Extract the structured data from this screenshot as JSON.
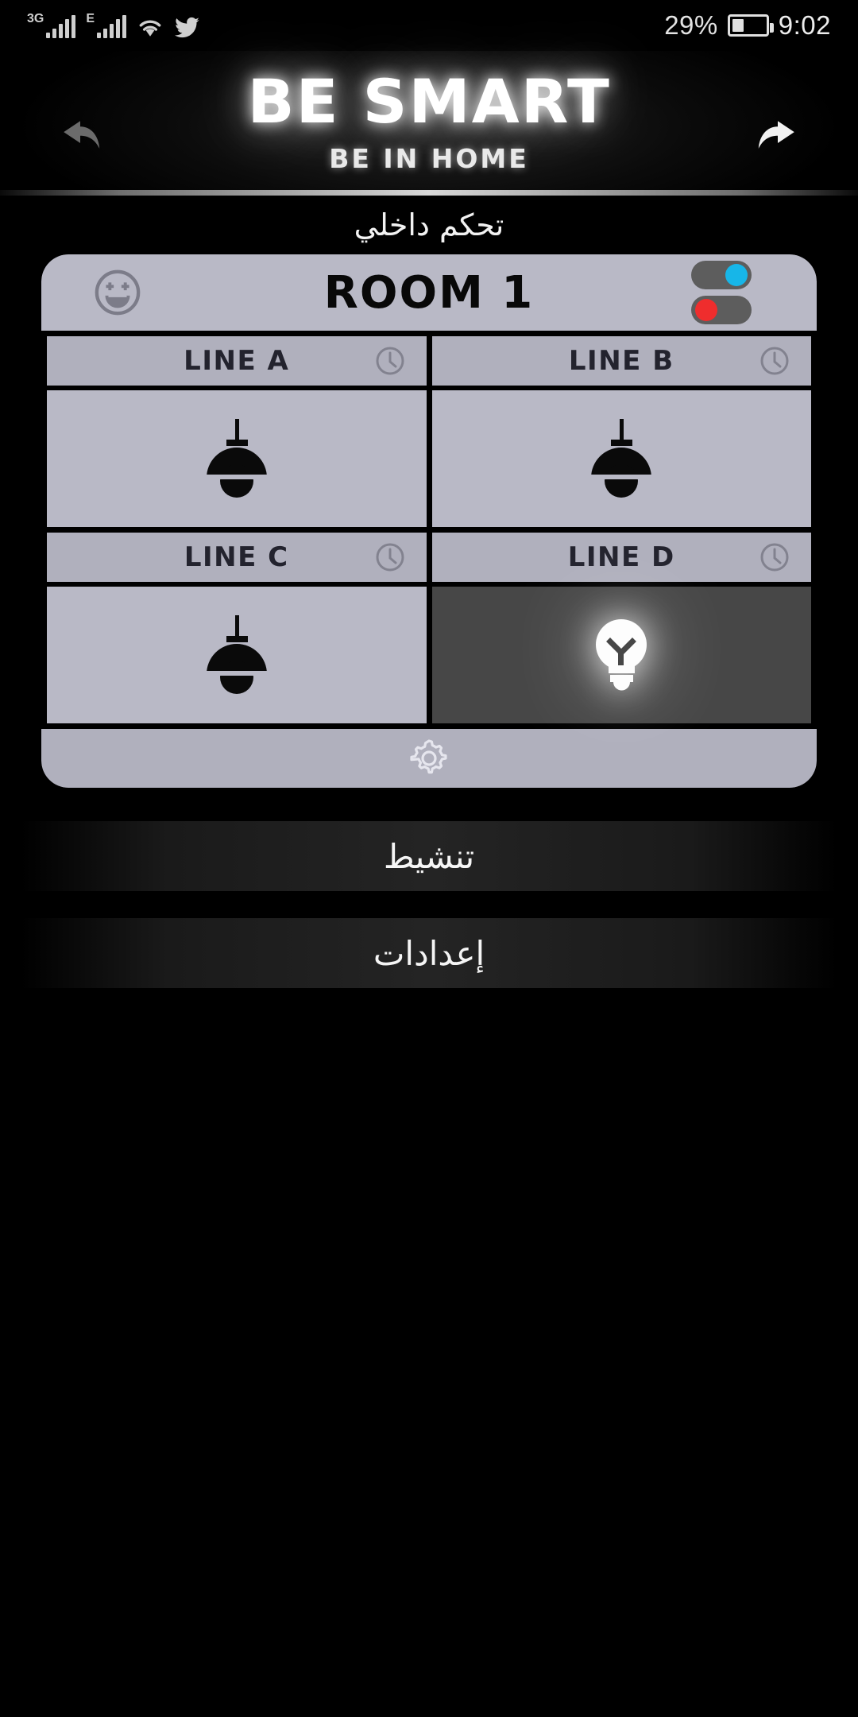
{
  "statusbar": {
    "network_tag_1": "3G",
    "network_tag_2": "E",
    "wifi_icon": "wifi-icon",
    "twitter_icon": "twitter-bird-icon",
    "battery_percent": "29%",
    "time": "9:02"
  },
  "header": {
    "back_icon": "back-arrow-icon",
    "forward_icon": "forward-arrow-icon",
    "title": "BE SMART",
    "subtitle": "BE IN HOME"
  },
  "section": {
    "caption": "تحكم داخلي"
  },
  "room_card": {
    "mood_icon": "smiley-face-icon",
    "title": "ROOM 1",
    "toggles": [
      {
        "name": "power-toggle",
        "state": "on",
        "knob_color": "#17b6e8"
      },
      {
        "name": "alarm-toggle",
        "state": "off",
        "knob_color": "#ef2d2d"
      }
    ],
    "lines": [
      {
        "label": "LINE A",
        "timer_icon": "clock-icon",
        "lamp_state": "off",
        "lamp_icon": "pendant-lamp-icon"
      },
      {
        "label": "LINE B",
        "timer_icon": "clock-icon",
        "lamp_state": "off",
        "lamp_icon": "pendant-lamp-icon"
      },
      {
        "label": "LINE C",
        "timer_icon": "clock-icon",
        "lamp_state": "off",
        "lamp_icon": "pendant-lamp-icon"
      },
      {
        "label": "LINE D",
        "timer_icon": "clock-icon",
        "lamp_state": "on",
        "lamp_icon": "light-bulb-icon"
      }
    ],
    "settings_icon": "gear-icon"
  },
  "actions": {
    "activate_label": "تنشيط",
    "settings_label": "إعدادات"
  },
  "colors": {
    "card_bg": "#b9b9c6",
    "header_bar": "#b0b0bd",
    "cell_on_bg": "#474747",
    "toggle_on": "#17b6e8",
    "toggle_off": "#ef2d2d",
    "page_bg": "#000000"
  }
}
